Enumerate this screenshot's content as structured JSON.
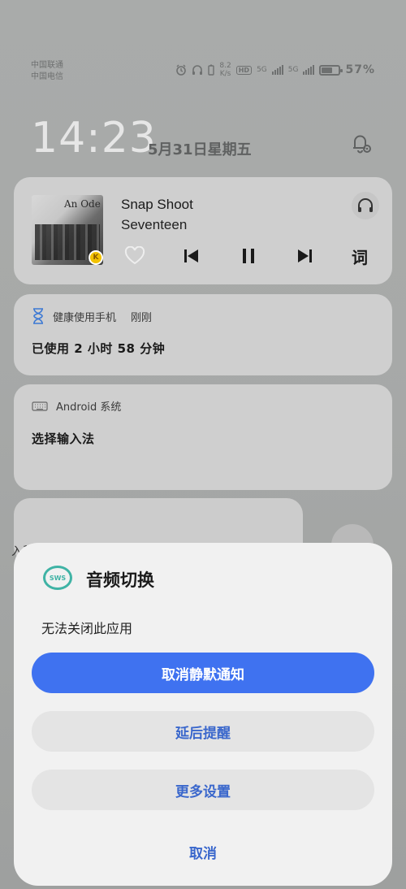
{
  "status_bar": {
    "carrier_1": "中国联通",
    "carrier_2": "中国电信",
    "net_speed_value": "8.2",
    "net_speed_unit": "K/s",
    "hd_label": "HD",
    "signal_1_label": "5G",
    "signal_2_label": "5G",
    "battery_percent": "57%",
    "battery_level": 0.57,
    "icons": [
      "alarm-icon",
      "headphone-icon",
      "battery-small-icon",
      "signal-icon",
      "battery-icon"
    ]
  },
  "lockscreen": {
    "time": "14:23",
    "date": "5月31日星期五",
    "bell_icon": "notification-settings-icon"
  },
  "music_card": {
    "album_text": "An Ode",
    "song_title": "Snap Shoot",
    "artist": "Seventeen",
    "lyrics_label": "词",
    "badge_text": "K"
  },
  "health_notification": {
    "app_name": "健康使用手机",
    "time": "刚刚",
    "body": "已使用 2 小时 58 分钟"
  },
  "android_notification": {
    "app_name": "Android 系统",
    "body": "选择输入法"
  },
  "partial_notification": {
    "text": "入稳"
  },
  "action_sheet": {
    "logo_text": "SWS",
    "title": "音频切换",
    "message": "无法关闭此应用",
    "primary_button": "取消静默通知",
    "delay_button": "延后提醒",
    "more_button": "更多设置",
    "cancel_button": "取消"
  },
  "colors": {
    "primary": "#3f72f0",
    "link": "#3a67cc",
    "logo": "#3fb3a5"
  }
}
